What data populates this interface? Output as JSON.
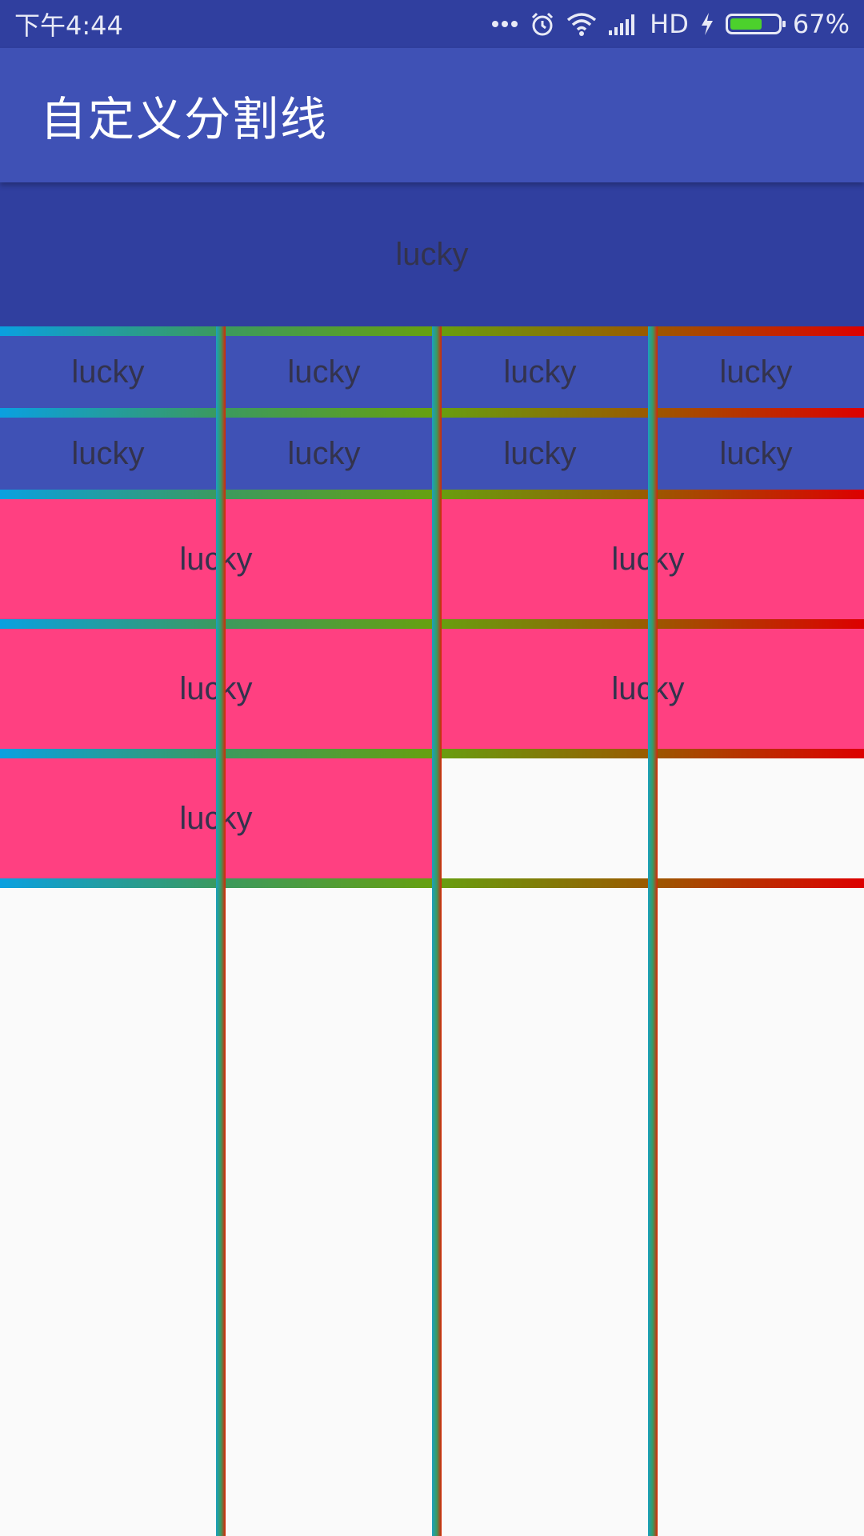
{
  "status_bar": {
    "time": "下午4:44",
    "more_icon": "ellipsis-icon",
    "alarm_icon": "alarm-icon",
    "wifi_icon": "wifi-icon",
    "signal_icon": "signal-icon",
    "network_label": "HD",
    "charging_icon": "bolt-icon",
    "battery_percent": "67%",
    "battery_level": 0.67
  },
  "toolbar": {
    "title": "自定义分割线",
    "color": "#3f51b5"
  },
  "colors": {
    "status_bar": "#303f9f",
    "full_row": "#303f9f",
    "four_col_rows": "#3f51b5",
    "two_col_rows": "#ff4081",
    "background": "#fafafa",
    "divider_gradient_start": "#0aa0e0",
    "divider_gradient_end": "#dd0000"
  },
  "grid": {
    "rows": [
      {
        "items": [
          "lucky"
        ]
      },
      {
        "items": [
          "lucky",
          "lucky",
          "lucky",
          "lucky"
        ]
      },
      {
        "items": [
          "lucky",
          "lucky",
          "lucky",
          "lucky"
        ]
      },
      {
        "items": [
          "lucky",
          "lucky"
        ]
      },
      {
        "items": [
          "lucky",
          "lucky"
        ]
      },
      {
        "items": [
          "lucky"
        ]
      }
    ]
  }
}
